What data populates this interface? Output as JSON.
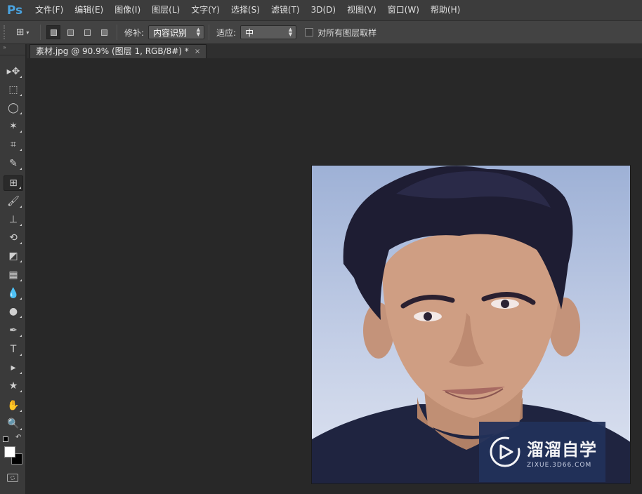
{
  "app": {
    "logo": "Ps",
    "accent": "#4aa3df"
  },
  "menu": [
    "文件(F)",
    "编辑(E)",
    "图像(I)",
    "图层(L)",
    "文字(Y)",
    "选择(S)",
    "滤镜(T)",
    "3D(D)",
    "视图(V)",
    "窗口(W)",
    "帮助(H)"
  ],
  "options": {
    "tool_icon": "patch-tool-icon",
    "patch_label": "修补:",
    "patch_value": "内容识别",
    "adapt_label": "适应:",
    "adapt_value": "中",
    "sample_all_label": "对所有图层取样",
    "sample_all_checked": false
  },
  "document": {
    "tab_title": "素材.jpg @ 90.9% (图层 1, RGB/8#) *",
    "close": "×"
  },
  "tools": [
    "move-tool-icon",
    "marquee-tool-icon",
    "lasso-tool-icon",
    "magic-wand-icon",
    "crop-tool-icon",
    "eyedropper-icon",
    "patch-tool-icon",
    "brush-tool-icon",
    "stamp-tool-icon",
    "history-brush-icon",
    "eraser-icon",
    "gradient-icon",
    "blur-tool-icon",
    "dodge-tool-icon",
    "pen-tool-icon",
    "type-tool-icon",
    "path-select-icon",
    "shape-tool-icon",
    "hand-tool-icon",
    "zoom-tool-icon"
  ],
  "tool_glyphs": [
    "▸✥",
    "⬚",
    "◯",
    "✶",
    "⌗",
    "✎",
    "⊞",
    "🖌",
    "⊥",
    "⟲",
    "◩",
    "▦",
    "💧",
    "●",
    "✒",
    "T",
    "▸",
    "★",
    "✋",
    "🔍"
  ],
  "colors": {
    "foreground": "#ffffff",
    "background": "#000000"
  },
  "watermark": {
    "main": "溜溜自学",
    "sub": "ZIXUE.3D66.COM"
  }
}
